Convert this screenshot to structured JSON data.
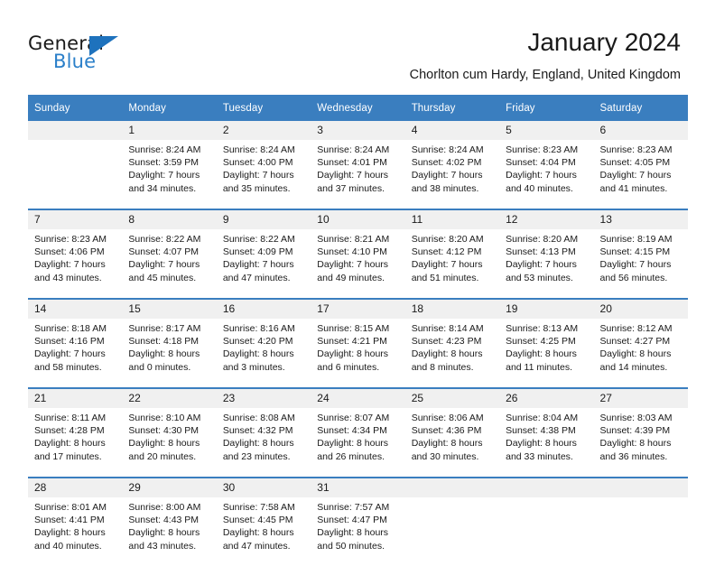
{
  "brand": {
    "name_part1": "General",
    "name_part2": "Blue",
    "logo_icon": "blue-triangle-icon"
  },
  "header": {
    "month_title": "January 2024",
    "location": "Chorlton cum Hardy, England, United Kingdom"
  },
  "colors": {
    "header_blue": "#3a7ebf",
    "brand_blue": "#2a7fc9",
    "daynum_bg": "#f0f0f0",
    "text": "#1a1a1a"
  },
  "calendar": {
    "weekday_headers": [
      "Sunday",
      "Monday",
      "Tuesday",
      "Wednesday",
      "Thursday",
      "Friday",
      "Saturday"
    ],
    "weeks": [
      [
        {
          "day": "",
          "blank": true,
          "sunrise": "",
          "sunset": "",
          "daylight_line1": "",
          "daylight_line2": ""
        },
        {
          "day": "1",
          "sunrise": "Sunrise: 8:24 AM",
          "sunset": "Sunset: 3:59 PM",
          "daylight_line1": "Daylight: 7 hours",
          "daylight_line2": "and 34 minutes."
        },
        {
          "day": "2",
          "sunrise": "Sunrise: 8:24 AM",
          "sunset": "Sunset: 4:00 PM",
          "daylight_line1": "Daylight: 7 hours",
          "daylight_line2": "and 35 minutes."
        },
        {
          "day": "3",
          "sunrise": "Sunrise: 8:24 AM",
          "sunset": "Sunset: 4:01 PM",
          "daylight_line1": "Daylight: 7 hours",
          "daylight_line2": "and 37 minutes."
        },
        {
          "day": "4",
          "sunrise": "Sunrise: 8:24 AM",
          "sunset": "Sunset: 4:02 PM",
          "daylight_line1": "Daylight: 7 hours",
          "daylight_line2": "and 38 minutes."
        },
        {
          "day": "5",
          "sunrise": "Sunrise: 8:23 AM",
          "sunset": "Sunset: 4:04 PM",
          "daylight_line1": "Daylight: 7 hours",
          "daylight_line2": "and 40 minutes."
        },
        {
          "day": "6",
          "sunrise": "Sunrise: 8:23 AM",
          "sunset": "Sunset: 4:05 PM",
          "daylight_line1": "Daylight: 7 hours",
          "daylight_line2": "and 41 minutes."
        }
      ],
      [
        {
          "day": "7",
          "sunrise": "Sunrise: 8:23 AM",
          "sunset": "Sunset: 4:06 PM",
          "daylight_line1": "Daylight: 7 hours",
          "daylight_line2": "and 43 minutes."
        },
        {
          "day": "8",
          "sunrise": "Sunrise: 8:22 AM",
          "sunset": "Sunset: 4:07 PM",
          "daylight_line1": "Daylight: 7 hours",
          "daylight_line2": "and 45 minutes."
        },
        {
          "day": "9",
          "sunrise": "Sunrise: 8:22 AM",
          "sunset": "Sunset: 4:09 PM",
          "daylight_line1": "Daylight: 7 hours",
          "daylight_line2": "and 47 minutes."
        },
        {
          "day": "10",
          "sunrise": "Sunrise: 8:21 AM",
          "sunset": "Sunset: 4:10 PM",
          "daylight_line1": "Daylight: 7 hours",
          "daylight_line2": "and 49 minutes."
        },
        {
          "day": "11",
          "sunrise": "Sunrise: 8:20 AM",
          "sunset": "Sunset: 4:12 PM",
          "daylight_line1": "Daylight: 7 hours",
          "daylight_line2": "and 51 minutes."
        },
        {
          "day": "12",
          "sunrise": "Sunrise: 8:20 AM",
          "sunset": "Sunset: 4:13 PM",
          "daylight_line1": "Daylight: 7 hours",
          "daylight_line2": "and 53 minutes."
        },
        {
          "day": "13",
          "sunrise": "Sunrise: 8:19 AM",
          "sunset": "Sunset: 4:15 PM",
          "daylight_line1": "Daylight: 7 hours",
          "daylight_line2": "and 56 minutes."
        }
      ],
      [
        {
          "day": "14",
          "sunrise": "Sunrise: 8:18 AM",
          "sunset": "Sunset: 4:16 PM",
          "daylight_line1": "Daylight: 7 hours",
          "daylight_line2": "and 58 minutes."
        },
        {
          "day": "15",
          "sunrise": "Sunrise: 8:17 AM",
          "sunset": "Sunset: 4:18 PM",
          "daylight_line1": "Daylight: 8 hours",
          "daylight_line2": "and 0 minutes."
        },
        {
          "day": "16",
          "sunrise": "Sunrise: 8:16 AM",
          "sunset": "Sunset: 4:20 PM",
          "daylight_line1": "Daylight: 8 hours",
          "daylight_line2": "and 3 minutes."
        },
        {
          "day": "17",
          "sunrise": "Sunrise: 8:15 AM",
          "sunset": "Sunset: 4:21 PM",
          "daylight_line1": "Daylight: 8 hours",
          "daylight_line2": "and 6 minutes."
        },
        {
          "day": "18",
          "sunrise": "Sunrise: 8:14 AM",
          "sunset": "Sunset: 4:23 PM",
          "daylight_line1": "Daylight: 8 hours",
          "daylight_line2": "and 8 minutes."
        },
        {
          "day": "19",
          "sunrise": "Sunrise: 8:13 AM",
          "sunset": "Sunset: 4:25 PM",
          "daylight_line1": "Daylight: 8 hours",
          "daylight_line2": "and 11 minutes."
        },
        {
          "day": "20",
          "sunrise": "Sunrise: 8:12 AM",
          "sunset": "Sunset: 4:27 PM",
          "daylight_line1": "Daylight: 8 hours",
          "daylight_line2": "and 14 minutes."
        }
      ],
      [
        {
          "day": "21",
          "sunrise": "Sunrise: 8:11 AM",
          "sunset": "Sunset: 4:28 PM",
          "daylight_line1": "Daylight: 8 hours",
          "daylight_line2": "and 17 minutes."
        },
        {
          "day": "22",
          "sunrise": "Sunrise: 8:10 AM",
          "sunset": "Sunset: 4:30 PM",
          "daylight_line1": "Daylight: 8 hours",
          "daylight_line2": "and 20 minutes."
        },
        {
          "day": "23",
          "sunrise": "Sunrise: 8:08 AM",
          "sunset": "Sunset: 4:32 PM",
          "daylight_line1": "Daylight: 8 hours",
          "daylight_line2": "and 23 minutes."
        },
        {
          "day": "24",
          "sunrise": "Sunrise: 8:07 AM",
          "sunset": "Sunset: 4:34 PM",
          "daylight_line1": "Daylight: 8 hours",
          "daylight_line2": "and 26 minutes."
        },
        {
          "day": "25",
          "sunrise": "Sunrise: 8:06 AM",
          "sunset": "Sunset: 4:36 PM",
          "daylight_line1": "Daylight: 8 hours",
          "daylight_line2": "and 30 minutes."
        },
        {
          "day": "26",
          "sunrise": "Sunrise: 8:04 AM",
          "sunset": "Sunset: 4:38 PM",
          "daylight_line1": "Daylight: 8 hours",
          "daylight_line2": "and 33 minutes."
        },
        {
          "day": "27",
          "sunrise": "Sunrise: 8:03 AM",
          "sunset": "Sunset: 4:39 PM",
          "daylight_line1": "Daylight: 8 hours",
          "daylight_line2": "and 36 minutes."
        }
      ],
      [
        {
          "day": "28",
          "sunrise": "Sunrise: 8:01 AM",
          "sunset": "Sunset: 4:41 PM",
          "daylight_line1": "Daylight: 8 hours",
          "daylight_line2": "and 40 minutes."
        },
        {
          "day": "29",
          "sunrise": "Sunrise: 8:00 AM",
          "sunset": "Sunset: 4:43 PM",
          "daylight_line1": "Daylight: 8 hours",
          "daylight_line2": "and 43 minutes."
        },
        {
          "day": "30",
          "sunrise": "Sunrise: 7:58 AM",
          "sunset": "Sunset: 4:45 PM",
          "daylight_line1": "Daylight: 8 hours",
          "daylight_line2": "and 47 minutes."
        },
        {
          "day": "31",
          "sunrise": "Sunrise: 7:57 AM",
          "sunset": "Sunset: 4:47 PM",
          "daylight_line1": "Daylight: 8 hours",
          "daylight_line2": "and 50 minutes."
        },
        {
          "day": "",
          "blank": true,
          "sunrise": "",
          "sunset": "",
          "daylight_line1": "",
          "daylight_line2": ""
        },
        {
          "day": "",
          "blank": true,
          "sunrise": "",
          "sunset": "",
          "daylight_line1": "",
          "daylight_line2": ""
        },
        {
          "day": "",
          "blank": true,
          "sunrise": "",
          "sunset": "",
          "daylight_line1": "",
          "daylight_line2": ""
        }
      ]
    ]
  }
}
